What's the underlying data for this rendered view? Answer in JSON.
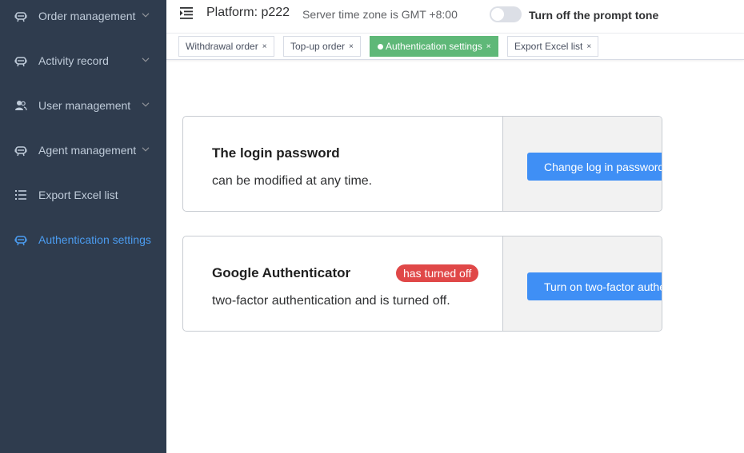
{
  "sidebar": {
    "items": [
      {
        "label": "Order management",
        "icon": "robot-icon",
        "has_chevron": true
      },
      {
        "label": "Activity record",
        "icon": "robot-icon",
        "has_chevron": true
      },
      {
        "label": "User management",
        "icon": "users-icon",
        "has_chevron": true
      },
      {
        "label": "Agent management",
        "icon": "robot-icon",
        "has_chevron": true
      },
      {
        "label": "Export Excel list",
        "icon": "list-icon",
        "has_chevron": false
      },
      {
        "label": "Authentication settings",
        "icon": "robot-icon",
        "has_chevron": false,
        "active": true
      }
    ]
  },
  "header": {
    "platform": "Platform: p222",
    "timezone": "Server time zone is GMT +8:00",
    "prompt_tone_label": "Turn off the prompt tone",
    "prompt_tone_on": false
  },
  "tags": [
    {
      "label": "Withdrawal order",
      "close": "×",
      "active": false
    },
    {
      "label": "Top-up order",
      "close": "×",
      "active": false
    },
    {
      "label": "Authentication settings",
      "close": "×",
      "active": true
    },
    {
      "label": "Export Excel list",
      "close": "×",
      "active": false
    }
  ],
  "cards": {
    "password": {
      "title": "The login password",
      "desc": "can be modified at any time.",
      "button": "Change log in password"
    },
    "google": {
      "title": "Google Authenticator",
      "badge": "has turned off",
      "desc": "two-factor authentication and is turned off.",
      "button": "Turn on two-factor authentication"
    }
  },
  "colors": {
    "sidebar_bg": "#2f3c4e",
    "sidebar_text": "#bfcbd9",
    "sidebar_active": "#4b9cf0",
    "tag_active": "#5fb878",
    "primary_button": "#3f8ff5",
    "badge_red": "#e04848"
  }
}
